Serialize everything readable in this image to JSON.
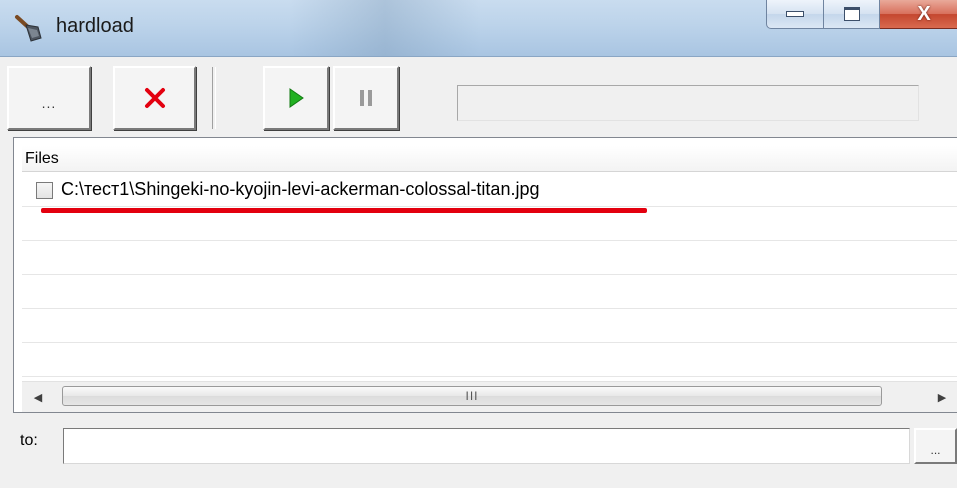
{
  "window": {
    "title": "hardload",
    "icon": "shovel-icon",
    "controls": [
      "minimize-icon",
      "maximize-icon",
      "close-icon"
    ],
    "close_glyph": "X"
  },
  "toolbar": {
    "browse_label": "...",
    "delete_icon": "red-x-icon",
    "delete_color": "#e3000f",
    "play_icon": "play-icon",
    "play_color": "#22b022",
    "pause_icon": "pause-icon",
    "progress": 0
  },
  "files": {
    "header": "Files",
    "rows": [
      {
        "checked": false,
        "name": "C:\\тест1\\Shingeki-no-kyojin-levi-ackerman-colossal-titan.jpg"
      },
      {
        "checked": false,
        "name": ""
      },
      {
        "checked": false,
        "name": ""
      },
      {
        "checked": false,
        "name": ""
      },
      {
        "checked": false,
        "name": ""
      },
      {
        "checked": false,
        "name": ""
      }
    ],
    "highlight_color": "#e3000f",
    "scrollbar_grip": "III"
  },
  "destination": {
    "label": "to:",
    "value": "",
    "browse_label": "..."
  }
}
